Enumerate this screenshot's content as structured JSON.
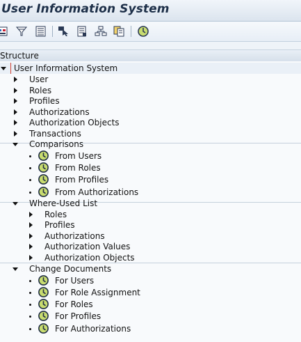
{
  "window": {
    "title": "User Information System"
  },
  "toolbar": {
    "icons": [
      "layout-icon",
      "filter-icon",
      "list-icon",
      "find-icon",
      "document-icon",
      "hierarchy-icon",
      "copy-icon",
      "execute-clock-icon"
    ]
  },
  "structure": {
    "header": "Structure"
  },
  "tree": {
    "root": "User Information System",
    "items": [
      {
        "label": "User",
        "level": 1,
        "type": "folder"
      },
      {
        "label": "Roles",
        "level": 1,
        "type": "folder"
      },
      {
        "label": "Profiles",
        "level": 1,
        "type": "folder"
      },
      {
        "label": "Authorizations",
        "level": 1,
        "type": "folder"
      },
      {
        "label": "Authorization Objects",
        "level": 1,
        "type": "folder"
      },
      {
        "label": "Transactions",
        "level": 1,
        "type": "folder"
      },
      {
        "label": "Comparisons",
        "level": 1,
        "type": "expanded"
      },
      {
        "label": "From Users",
        "level": 2,
        "type": "report"
      },
      {
        "label": "From Roles",
        "level": 2,
        "type": "report"
      },
      {
        "label": "From Profiles",
        "level": 2,
        "type": "report"
      },
      {
        "label": "From Authorizations",
        "level": 2,
        "type": "report"
      },
      {
        "label": "Where-Used List",
        "level": 1,
        "type": "expanded"
      },
      {
        "label": "Roles",
        "level": 2,
        "type": "folder"
      },
      {
        "label": "Profiles",
        "level": 2,
        "type": "folder"
      },
      {
        "label": "Authorizations",
        "level": 2,
        "type": "folder"
      },
      {
        "label": "Authorization Values",
        "level": 2,
        "type": "folder"
      },
      {
        "label": "Authorization Objects",
        "level": 2,
        "type": "folder"
      },
      {
        "label": "Change Documents",
        "level": 1,
        "type": "expanded"
      },
      {
        "label": "For Users",
        "level": 2,
        "type": "report"
      },
      {
        "label": "For Role Assignment",
        "level": 2,
        "type": "report"
      },
      {
        "label": "For Roles",
        "level": 2,
        "type": "report"
      },
      {
        "label": "For Profiles",
        "level": 2,
        "type": "report"
      },
      {
        "label": "For Authorizations",
        "level": 2,
        "type": "report"
      }
    ]
  },
  "colors": {
    "accent": "#1d2f48",
    "selection": "#d04030",
    "clock_green": "#b8d060"
  }
}
